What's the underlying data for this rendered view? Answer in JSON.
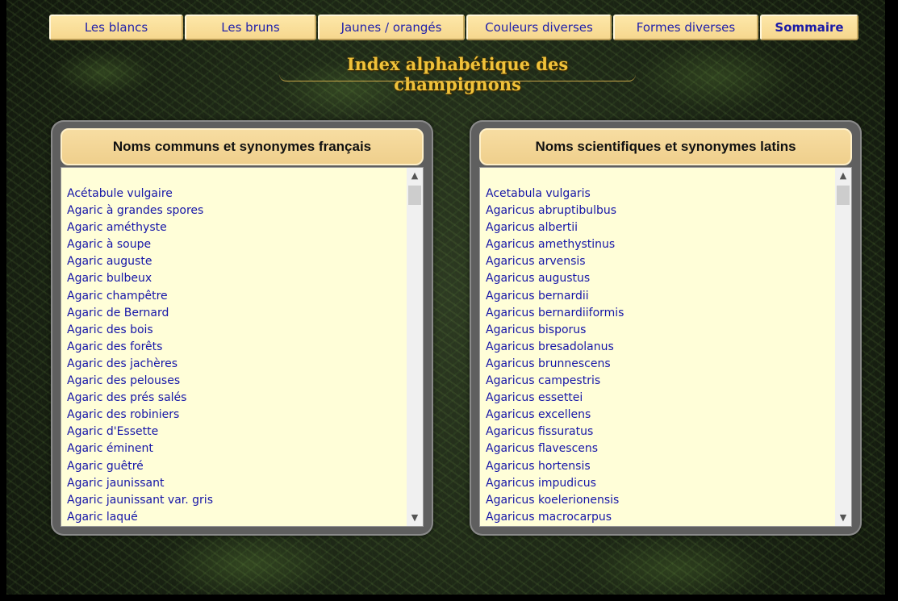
{
  "nav": {
    "tabs": [
      "Les blancs",
      "Les bruns",
      "Jaunes / orangés",
      "Couleurs diverses",
      "Formes diverses",
      "Sommaire"
    ]
  },
  "page": {
    "title": "Index alphabétique des champignons"
  },
  "left_panel": {
    "header": "Noms communs et synonymes français",
    "items": [
      "Acétabule vulgaire",
      "Agaric à grandes spores",
      "Agaric améthyste",
      "Agaric à soupe",
      "Agaric auguste",
      "Agaric bulbeux",
      "Agaric champêtre",
      "Agaric de Bernard",
      "Agaric des bois",
      "Agaric des forêts",
      "Agaric des jachères",
      "Agaric des pelouses",
      "Agaric des prés salés",
      "Agaric des robiniers",
      "Agaric d'Essette",
      "Agaric éminent",
      "Agaric guêtré",
      "Agaric jaunissant",
      "Agaric jaunissant var. gris",
      "Agaric laqué"
    ]
  },
  "right_panel": {
    "header": "Noms scientifiques et synonymes latins",
    "items": [
      "Acetabula vulgaris",
      "Agaricus abruptibulbus",
      "Agaricus albertii",
      "Agaricus amethystinus",
      "Agaricus arvensis",
      "Agaricus augustus",
      "Agaricus bernardii",
      "Agaricus bernardiiformis",
      "Agaricus bisporus",
      "Agaricus bresadolanus",
      "Agaricus brunnescens",
      "Agaricus campestris",
      "Agaricus essettei",
      "Agaricus excellens",
      "Agaricus fissuratus",
      "Agaricus flavescens",
      "Agaricus hortensis",
      "Agaricus impudicus",
      "Agaricus koelerionensis",
      "Agaricus macrocarpus"
    ]
  },
  "scrollbar": {
    "up_icon": "chevron-up-icon",
    "down_icon": "chevron-down-icon"
  },
  "colors": {
    "link": "#1616a8",
    "tab_background": "#f6d78e",
    "title": "#f0c23a",
    "list_background": "#fffed8",
    "panel_frame": "#5f5f5f"
  }
}
